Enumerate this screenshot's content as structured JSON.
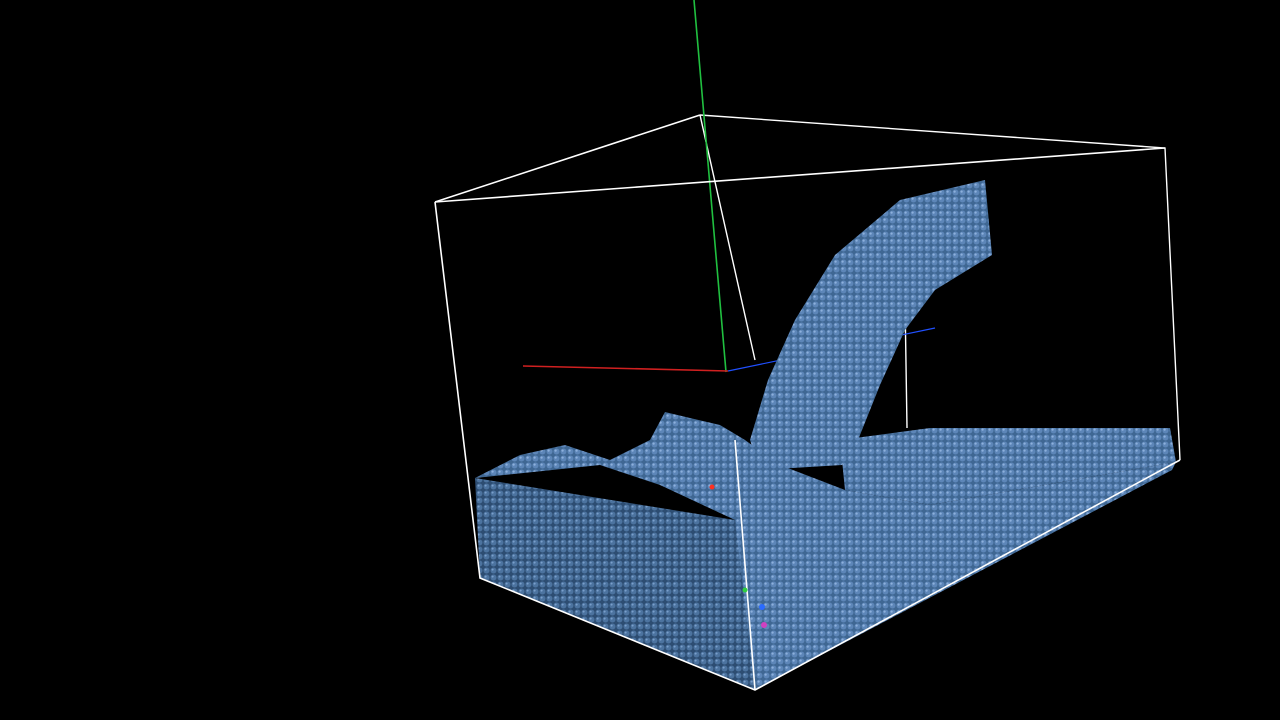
{
  "viewport": {
    "background": "#000000",
    "view_label": "",
    "icon": "particle-fluid-simulation"
  },
  "bounding_box": {
    "color": "#ffffff"
  },
  "axes": {
    "x_color": "#d02020",
    "y_color": "#20c040",
    "z_color": "#2050ff"
  },
  "fluid": {
    "particle_color": "#5d86b8",
    "highlight_color": "#8db0dc",
    "shadow_color": "#233a5a"
  },
  "markers": {
    "colors": [
      "#2a6bff",
      "#d040c0",
      "#ff3020",
      "#30d040"
    ]
  }
}
